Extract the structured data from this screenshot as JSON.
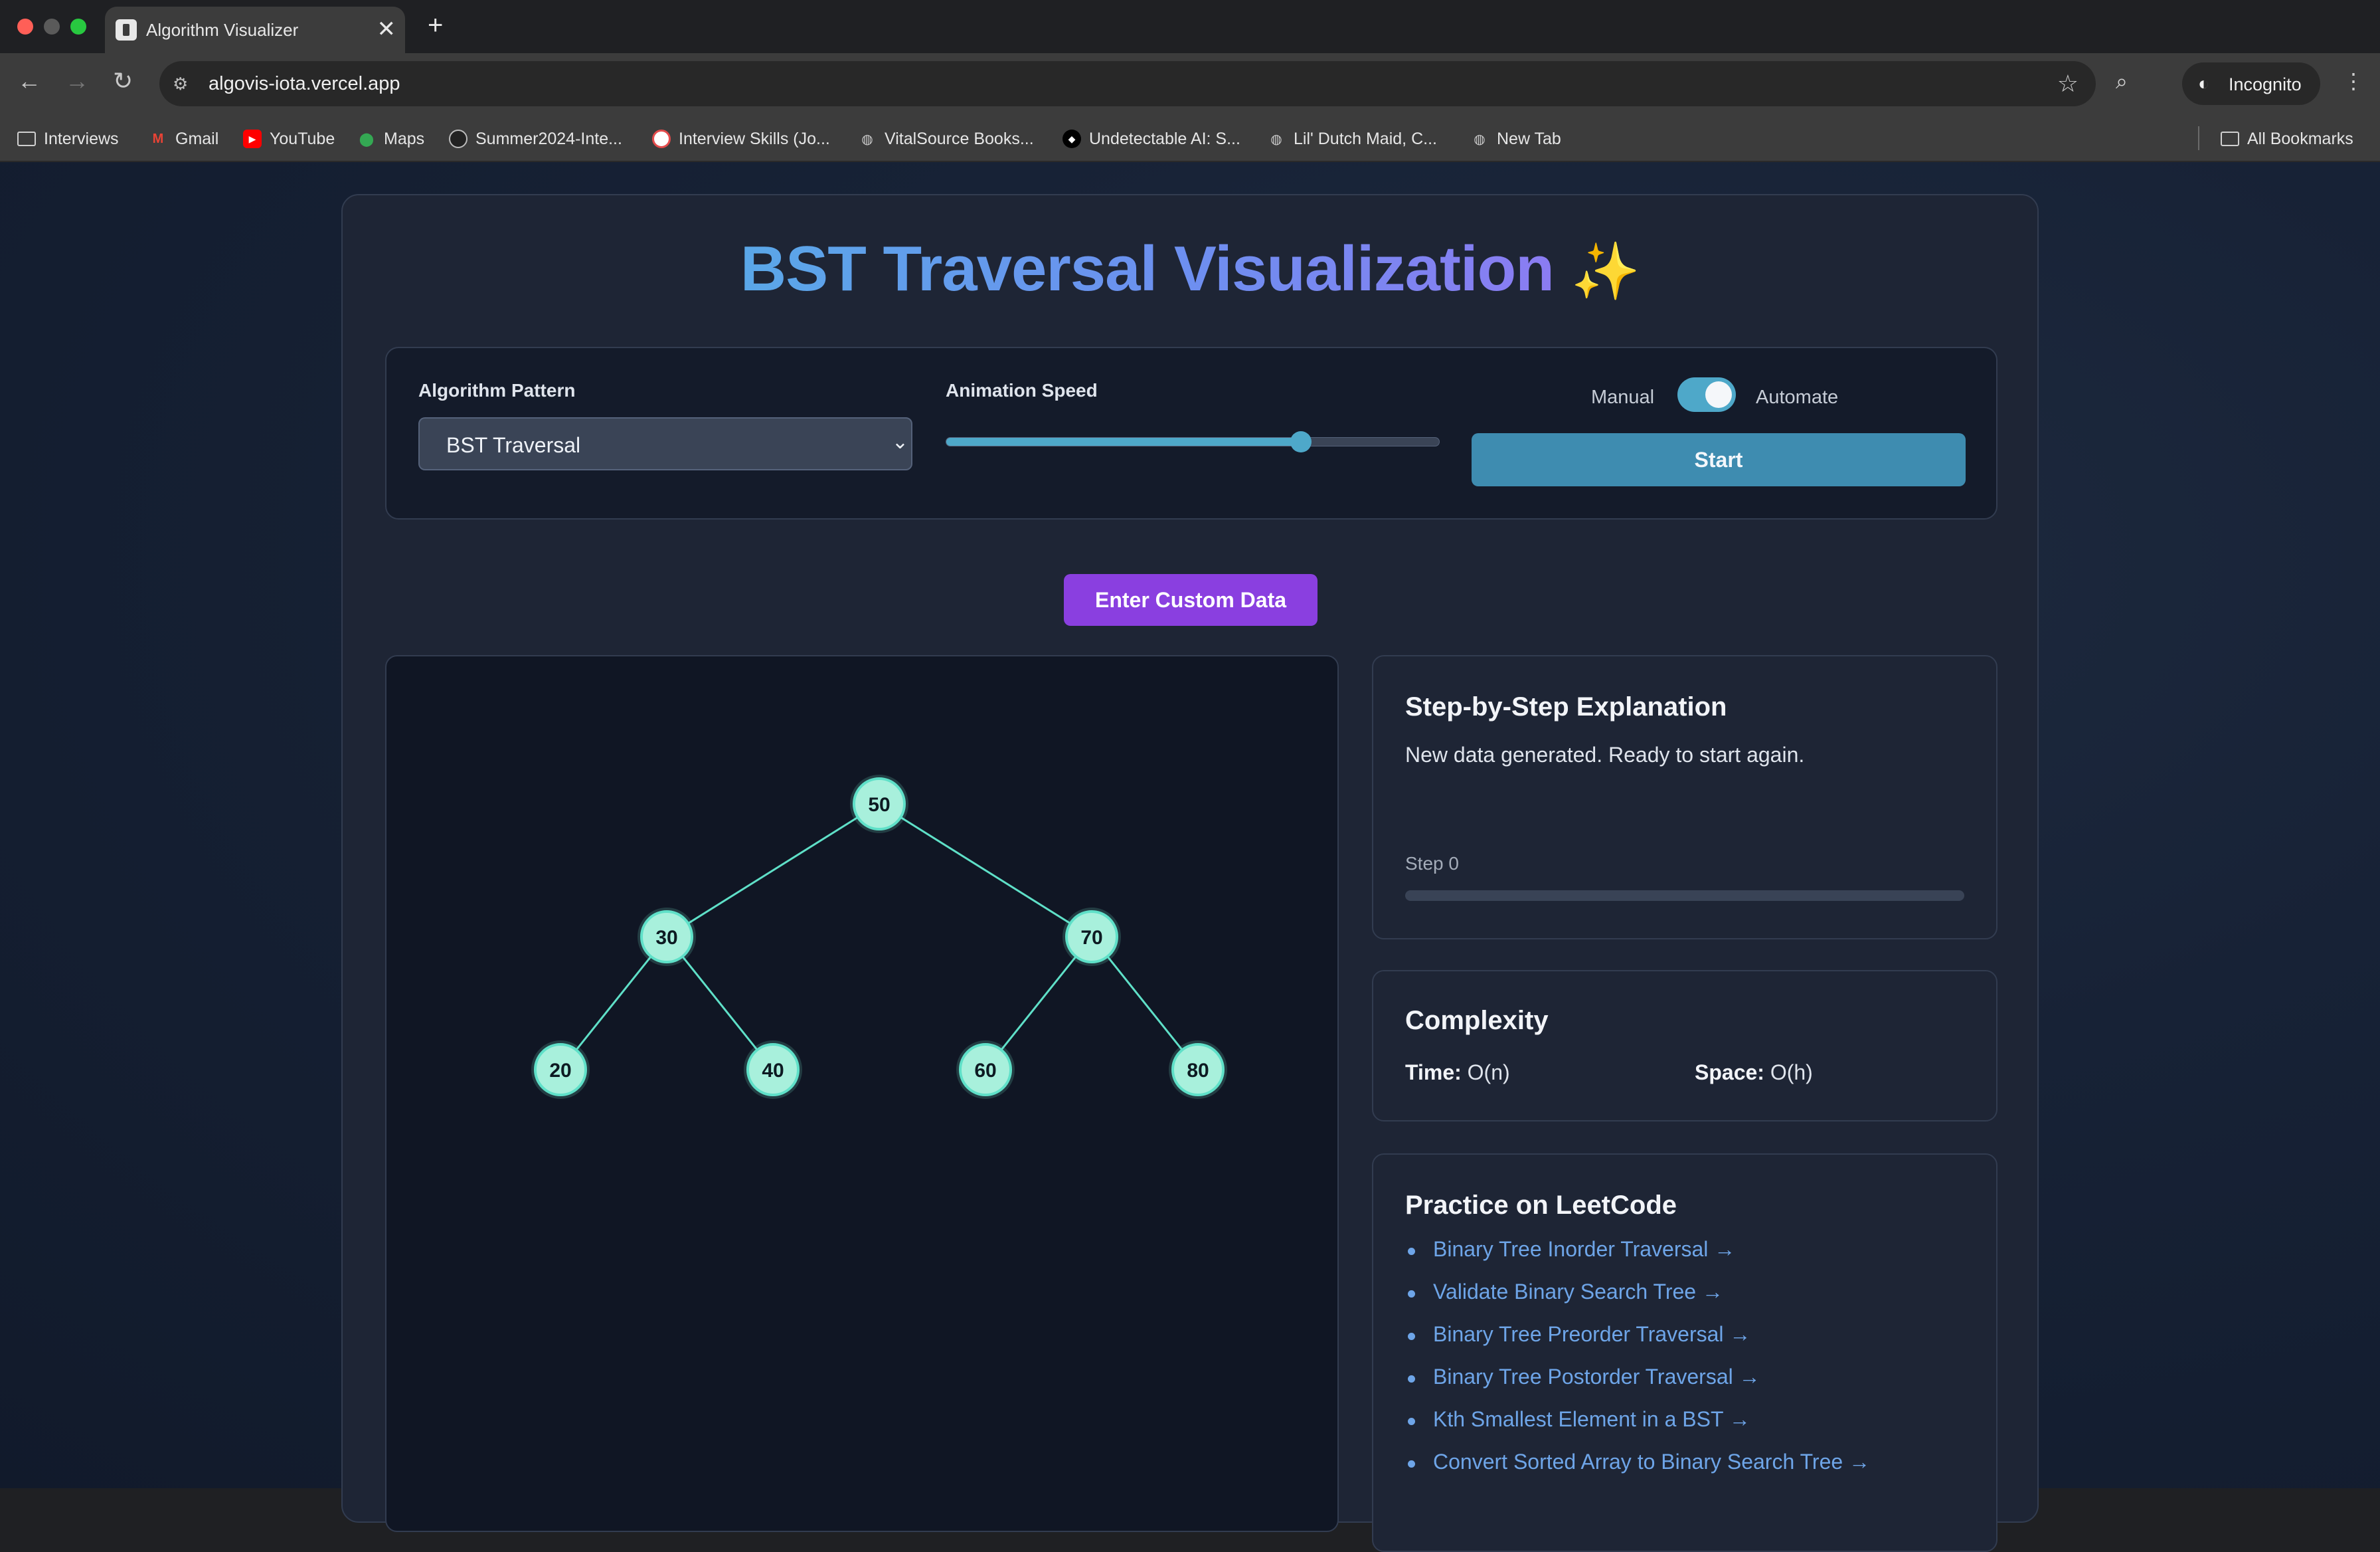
{
  "browser": {
    "tab_title": "Algorithm Visualizer",
    "tab_close": "✕",
    "new_tab": "+",
    "url": "algovis-iota.vercel.app",
    "incognito_label": "Incognito",
    "traffic_colors": [
      "#ff5f57",
      "#5a5a5a",
      "#28c840"
    ],
    "bookmarks": [
      {
        "label": "Interviews",
        "icon": "folder-icon"
      },
      {
        "label": "Gmail",
        "icon": "gmail-icon"
      },
      {
        "label": "YouTube",
        "icon": "youtube-icon"
      },
      {
        "label": "Maps",
        "icon": "maps-icon"
      },
      {
        "label": "Summer2024-Inte...",
        "icon": "github-icon"
      },
      {
        "label": "Interview Skills (Jo...",
        "icon": "site-icon"
      },
      {
        "label": "VitalSource Books...",
        "icon": "globe-icon"
      },
      {
        "label": "Undetectable AI: S...",
        "icon": "site-icon"
      },
      {
        "label": "Lil' Dutch Maid, C...",
        "icon": "globe-icon"
      },
      {
        "label": "New Tab",
        "icon": "globe-icon"
      }
    ],
    "all_bookmarks_label": "All Bookmarks"
  },
  "app": {
    "title": "BST Traversal Visualization",
    "title_emoji": "✨",
    "controls": {
      "pattern_label": "Algorithm Pattern",
      "pattern_value": "BST Traversal",
      "speed_label": "Animation Speed",
      "speed_fraction": 0.72,
      "mode_manual": "Manual",
      "mode_automate": "Automate",
      "automate_on": true,
      "start_label": "Start"
    },
    "custom_data_label": "Enter Custom Data",
    "tree": {
      "nodes": [
        "50",
        "30",
        "70",
        "20",
        "40",
        "60",
        "80"
      ],
      "node_fill": "#a8f0dc",
      "edge_color": "#5fe0c8"
    },
    "explanation": {
      "heading": "Step-by-Step Explanation",
      "text": "New data generated. Ready to start again.",
      "step_label": "Step 0",
      "progress": 0
    },
    "complexity": {
      "heading": "Complexity",
      "time_label": "Time:",
      "time_value": "O(n)",
      "space_label": "Space:",
      "space_value": "O(h)"
    },
    "leetcode": {
      "heading": "Practice on LeetCode",
      "links": [
        "Binary Tree Inorder Traversal →",
        "Validate Binary Search Tree →",
        "Binary Tree Preorder Traversal →",
        "Binary Tree Postorder Traversal →",
        "Kth Smallest Element in a BST →",
        "Convert Sorted Array to Binary Search Tree →"
      ]
    },
    "colors": {
      "accent": "#4ea8c9",
      "custom_button": "#8a3fe0",
      "link": "#6ea5e8"
    }
  }
}
